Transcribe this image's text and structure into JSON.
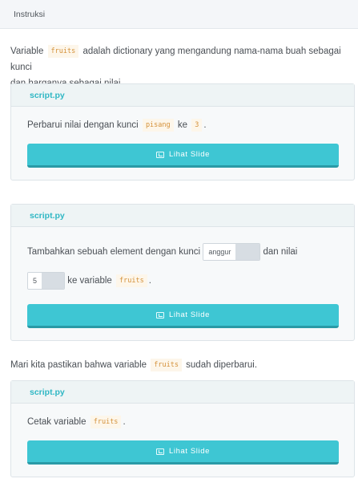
{
  "header": {
    "title": "Instruksi"
  },
  "intro": {
    "text_before": "Variable",
    "code": "fruits",
    "text_after_line1": "adalah dictionary yang mengandung nama-nama buah sebagai kunci",
    "text_line2": "dan harganya sebagai nilai."
  },
  "card1": {
    "filename": "script.py",
    "task_before": "Perbarui nilai dengan kunci",
    "key_code": "pisang",
    "task_middle": "ke",
    "value_code": "3",
    "task_end": ".",
    "button_label": "Lihat Slide"
  },
  "card2": {
    "filename": "script.py",
    "task_before": "Tambahkan sebuah element dengan kunci",
    "key_input": "anggur",
    "task_middle": "dan nilai",
    "value_input": "5",
    "task_after": "ke variable",
    "var_code": "fruits",
    "task_end": ".",
    "button_label": "Lihat Slide"
  },
  "outro": {
    "text_before": "Mari kita pastikan bahwa variable",
    "code": "fruits",
    "text_after": "sudah diperbarui."
  },
  "card3": {
    "filename": "script.py",
    "task_before": "Cetak variable",
    "var_code": "fruits",
    "task_end": ".",
    "button_label": "Lihat Slide"
  }
}
